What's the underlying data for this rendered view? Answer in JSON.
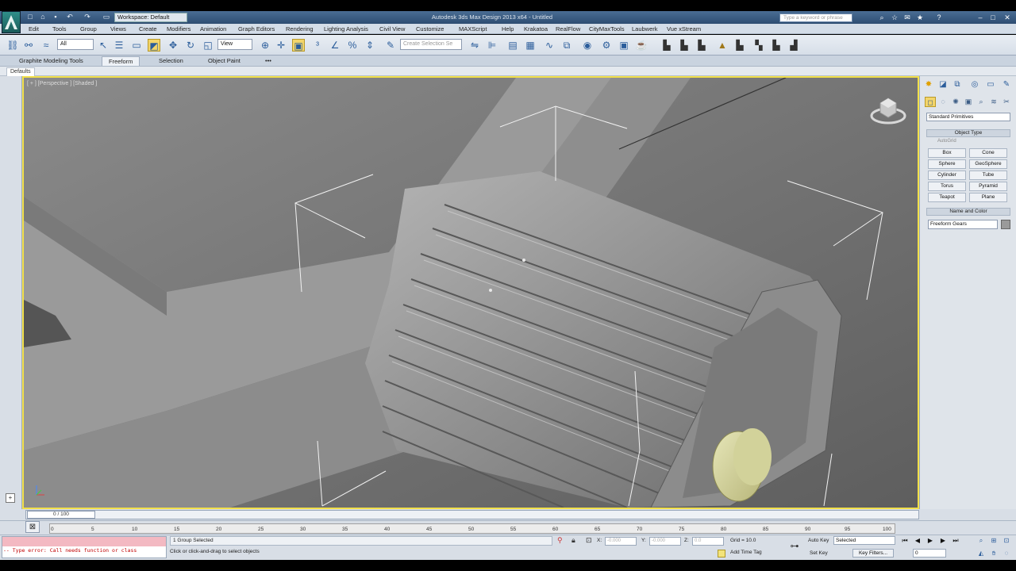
{
  "titlebar": {
    "workspace": "Workspace: Default",
    "title": "Autodesk 3ds Max Design 2013 x64 - Untitled",
    "search_placeholder": "Type a keyword or phrase",
    "quick_access": [
      "new-icon",
      "open-icon",
      "save-icon",
      "undo-icon",
      "redo-icon",
      "project-icon"
    ]
  },
  "menu": {
    "items": [
      "Edit",
      "Tools",
      "Group",
      "Views",
      "Create",
      "Modifiers",
      "Graph Editors",
      "Rendering",
      "Lighting Analysis",
      "Civil View",
      "Customize",
      "MAXScript",
      "Help",
      "Krakatoa",
      "RealFlow",
      "CityMaxTools",
      "Laubwerk",
      "Vue xStream"
    ]
  },
  "toolbar": {
    "selection_filter": "All",
    "reference_coord": "View",
    "named_selection": "Create Selection Se"
  },
  "ribbon": {
    "tabs": [
      "Graphite Modeling Tools",
      "Freeform",
      "Selection",
      "Object Paint"
    ],
    "more": "•••",
    "sub_label": "Defaults"
  },
  "viewport": {
    "label": "[ + ] [Perspective ] [Shaded ]"
  },
  "command_panel": {
    "category": "Standard Primitives",
    "object_type_title": "Object Type",
    "autogrid_label": "AutoGrid",
    "primitives": [
      "Box",
      "Cone",
      "Sphere",
      "GeoSphere",
      "Cylinder",
      "Tube",
      "Torus",
      "Pyramid",
      "Teapot",
      "Plane"
    ],
    "name_color_title": "Name and Color",
    "name_value": "Freeform Gears"
  },
  "timeline": {
    "frame_display": "0 / 100",
    "ticks": [
      "0",
      "5",
      "10",
      "15",
      "20",
      "25",
      "30",
      "35",
      "40",
      "45",
      "50",
      "55",
      "60",
      "65",
      "70",
      "75",
      "80",
      "85",
      "90",
      "95",
      "100"
    ]
  },
  "status": {
    "maxscript_error": "-- Type error: Call needs function or class",
    "selection": "1 Group Selected",
    "prompt": "Click or click-and-drag to select objects",
    "x_label": "X:",
    "y_label": "Y:",
    "z_label": "Z:",
    "x_value": "-0.000",
    "y_value": "-0.000",
    "z_value": "0.0",
    "grid": "Grid = 10.0",
    "add_time_tag": "Add Time Tag",
    "auto_key": "Auto Key",
    "set_key": "Set Key",
    "selected_dd": "Selected",
    "key_filters": "Key Filters...",
    "frame": "0"
  }
}
